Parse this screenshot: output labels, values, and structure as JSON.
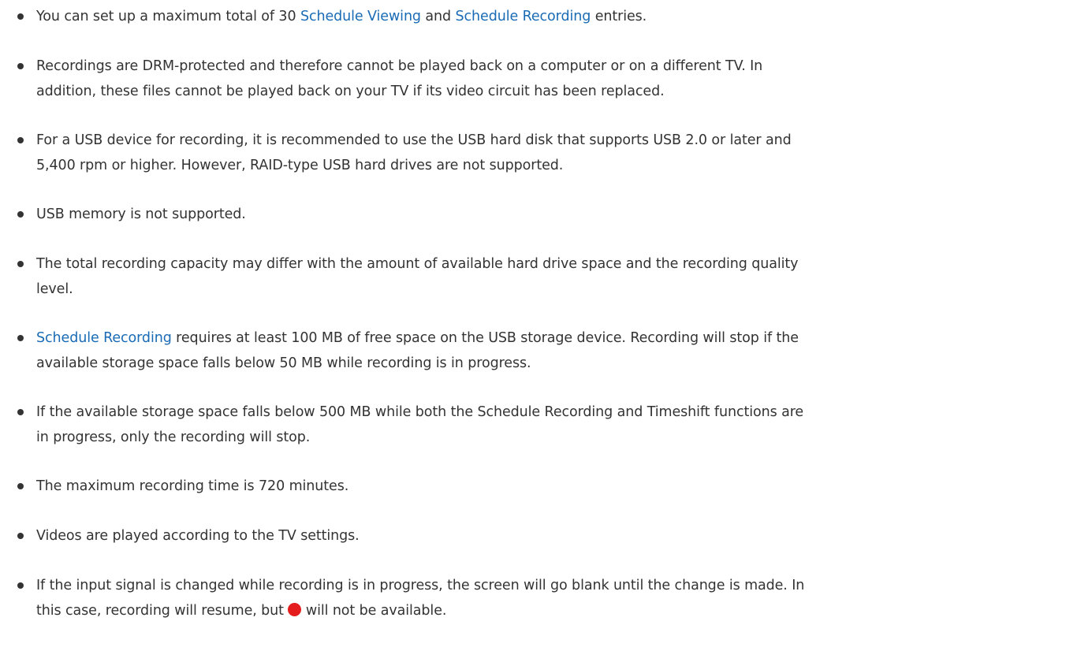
{
  "items": [
    {
      "pre": "You can set up a maximum total of 30 ",
      "link1": "Schedule Viewing",
      "mid": " and ",
      "link2": "Schedule Recording",
      "post": " entries."
    },
    {
      "line1": "Recordings are DRM-protected and therefore cannot be played back on a computer or on a different TV. In",
      "line2": "addition, these files cannot be played back on your TV if its video circuit has been replaced."
    },
    {
      "line1": "For a USB device for recording, it is recommended to use the USB hard disk that supports USB 2.0 or later and",
      "line2": "5,400 rpm or higher. However, RAID-type USB hard drives are not supported."
    },
    {
      "line1": "USB memory is not supported."
    },
    {
      "line1": "The total recording capacity may differ with the amount of available hard drive space and the recording quality",
      "line2": "level."
    },
    {
      "link": "Schedule Recording",
      "line1_rest": " requires at least 100 MB of free space on the USB storage device. Recording will stop if the",
      "line2": "available storage space falls below 50 MB while recording is in progress."
    },
    {
      "line1": "If the available storage space falls below 500 MB while both the Schedule Recording and Timeshift functions are",
      "line2": "in progress, only the recording will stop."
    },
    {
      "line1": "The maximum recording time is 720 minutes."
    },
    {
      "line1": "Videos are played according to the TV settings."
    },
    {
      "line1": "If the input signal is changed while recording is in progress, the screen will go blank until the change is made. In",
      "line2_pre": "this case, recording will resume, but ",
      "line2_post": " will not be available.",
      "icon": "record-icon",
      "icon_color": "#e51c1c"
    }
  ],
  "colors": {
    "text": "#333333",
    "link": "#1a6bb5",
    "background": "#ffffff"
  }
}
